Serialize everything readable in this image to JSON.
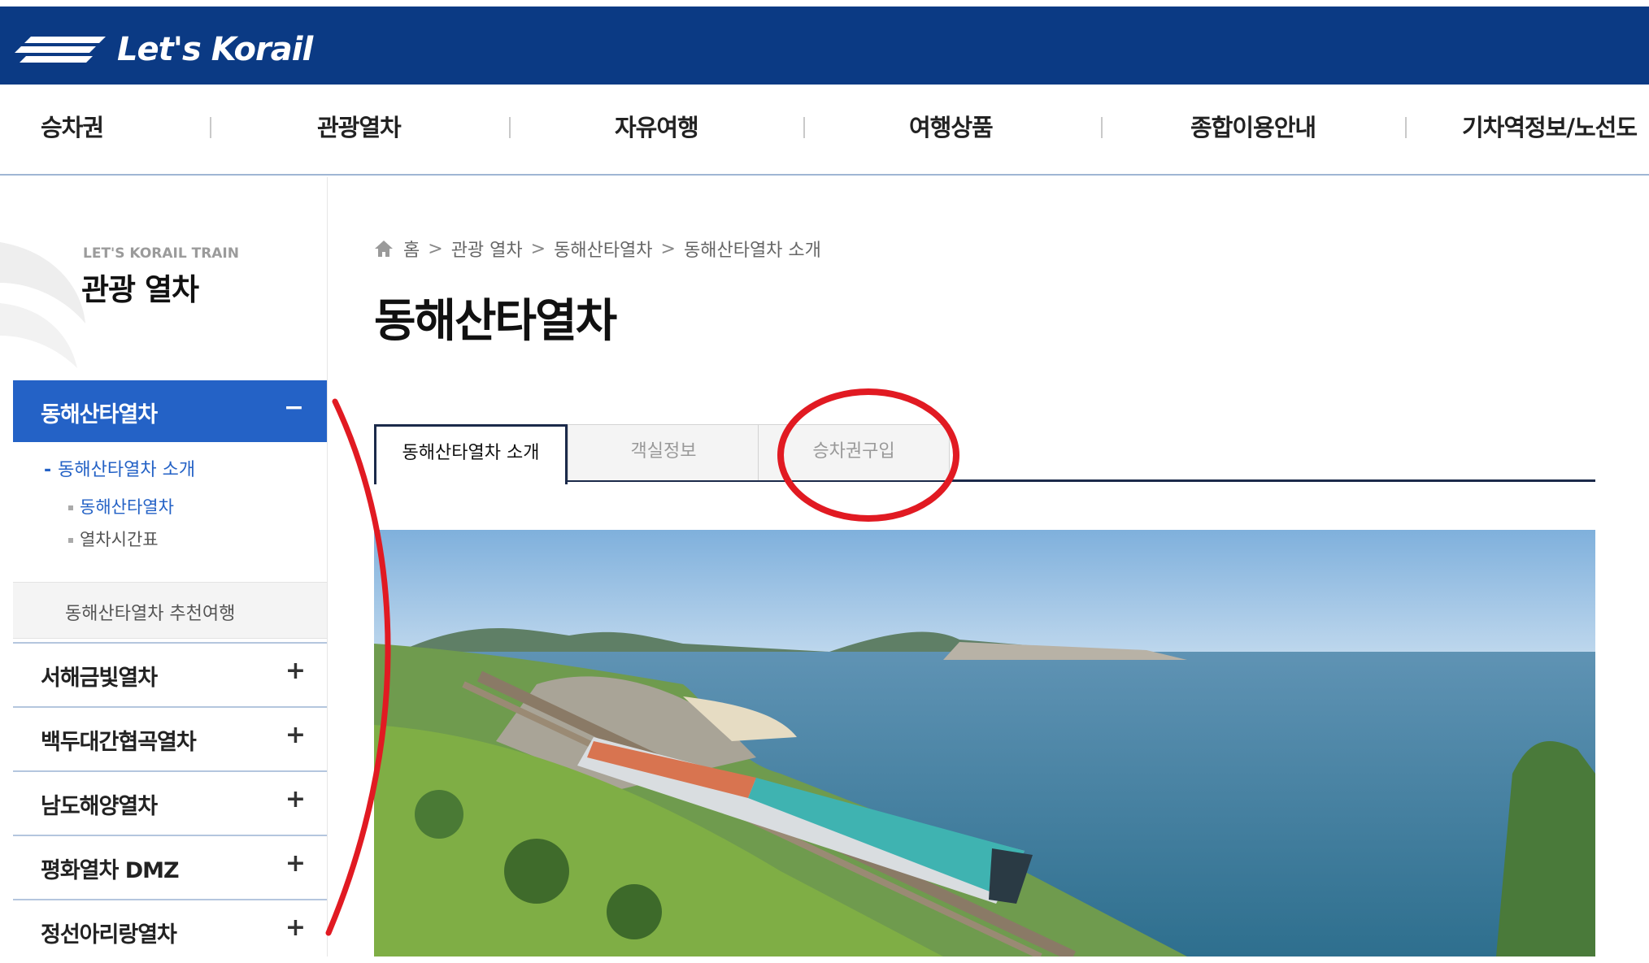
{
  "header": {
    "logo_text": "Let's Korail"
  },
  "gnb": {
    "items": [
      "승차권",
      "관광열차",
      "자유여행",
      "여행상품",
      "종합이용안내",
      "기차역정보/노선도"
    ]
  },
  "sidebar": {
    "subtitle": "LET'S KORAIL TRAIN",
    "title": "관광 열차",
    "active": {
      "label": "동해산타열차",
      "toggle": "−"
    },
    "sub_menu": [
      {
        "label": "동해산타열차 소개",
        "marker": "-"
      },
      {
        "label": "동해산타열차"
      },
      {
        "label": "열차시간표"
      }
    ],
    "gray_item": "동해산타열차 추천여행",
    "rows": [
      {
        "label": "서해금빛열차",
        "toggle": "+"
      },
      {
        "label": "백두대간협곡열차",
        "toggle": "+"
      },
      {
        "label": "남도해양열차",
        "toggle": "+"
      },
      {
        "label": "평화열차 DMZ",
        "toggle": "+"
      },
      {
        "label": "정선아리랑열차",
        "toggle": "+"
      }
    ]
  },
  "breadcrumb": [
    "홈",
    "관광 열차",
    "동해산타열차",
    "동해산타열차 소개"
  ],
  "breadcrumb_sep": ">",
  "page_title": "동해산타열차",
  "tabs": [
    {
      "label": "동해산타열차 소개",
      "active": true
    },
    {
      "label": "객실정보",
      "active": false
    },
    {
      "label": "승차권구입",
      "active": false
    }
  ],
  "colors": {
    "header_bg": "#0b3a84",
    "sidebar_active": "#2462c6",
    "annotation": "#e11a22"
  },
  "icons": [
    "home-icon",
    "logo-mark-icon",
    "train-photo"
  ]
}
